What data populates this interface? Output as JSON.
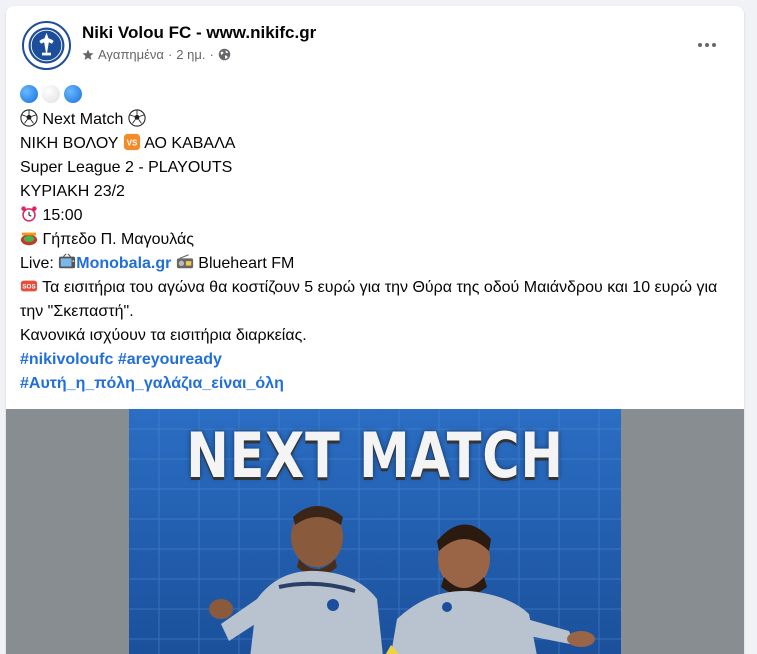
{
  "post": {
    "page_name": "Niki Volou FC - www.nikifc.gr",
    "meta": {
      "favorites_label": "Αγαπημένα",
      "separator": "·",
      "time": "2 ημ.",
      "separator2": "·"
    },
    "lines": {
      "next_match": "Next Match",
      "home_team": "ΝΙΚΗ ΒΟΛΟΥ",
      "away_team": "ΑΟ ΚΑΒΑΛΑ",
      "league": "Super League 2 - PLAYOUTS",
      "date": "ΚΥΡΙΑΚΗ 23/2",
      "time": "15:00",
      "stadium": "Γήπεδο Π. Μαγουλάς",
      "live_label": "Live:",
      "live_link": "Monobala.gr",
      "live_radio": "Blueheart FM",
      "tickets": "Τα εισιτήρια του αγώνα θα κοστίζουν 5 ευρώ για την Θύρα της οδού Μαιάνδρου και 10 ευρώ για την \"Σκεπαστή\".",
      "season_tickets": "Κανονικά ισχύουν τα εισιτήρια διαρκείας."
    },
    "hashtags": {
      "tag1": "#nikivoloufc",
      "tag2": "#areyouready",
      "tag3": "#Αυτή_η_πόλη_γαλάζια_είναι_όλη"
    },
    "vs_badge": "VS",
    "sos_badge": "SOS",
    "poster_title": "NEXT MATCH"
  },
  "icons": {
    "favorite": "star-icon",
    "audience": "globe-icon",
    "more": "more-dots-icon"
  },
  "colors": {
    "link": "#216fdb",
    "meta": "#65676b",
    "club_blue": "#1d4e9c"
  }
}
